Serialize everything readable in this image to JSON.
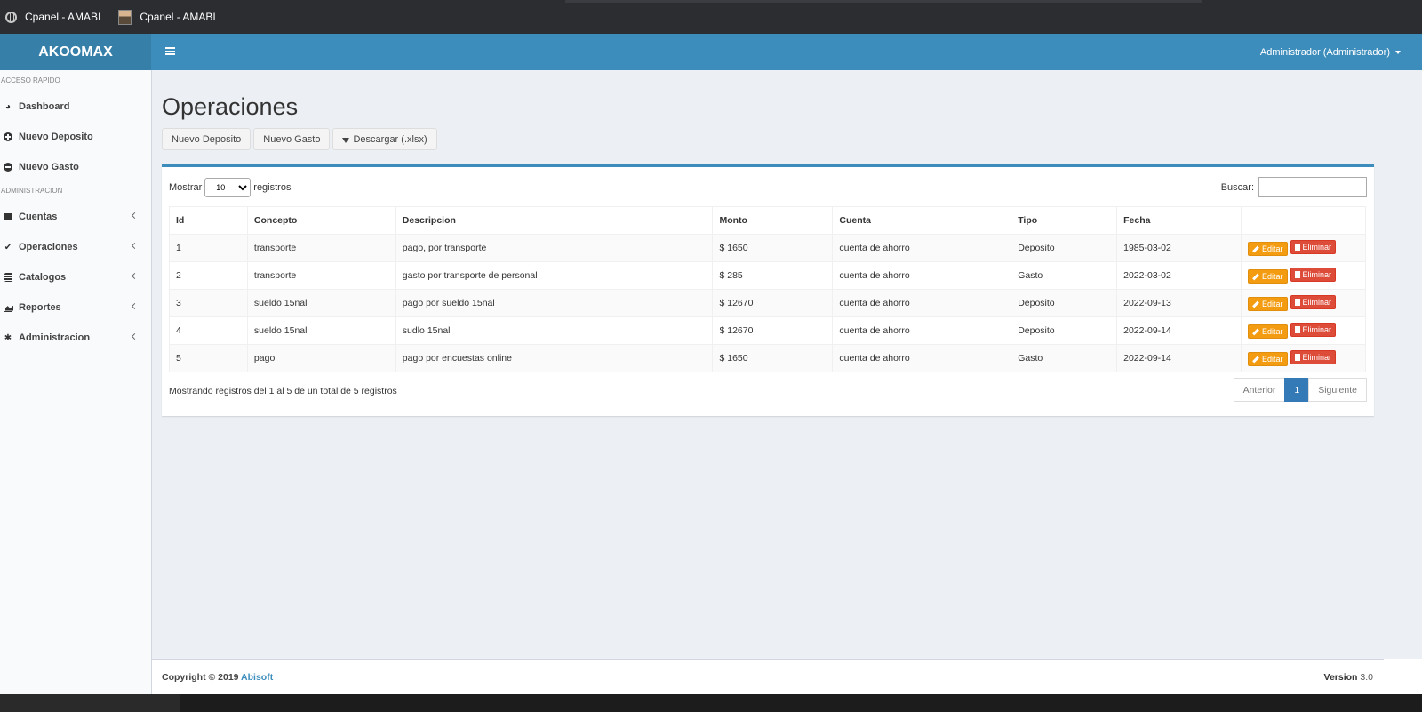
{
  "browser": {
    "tabs": [
      {
        "title": "Cpanel - AMABI",
        "icon": "globe-icon"
      },
      {
        "title": "Cpanel - AMABI",
        "icon": "user-photo-icon"
      }
    ]
  },
  "header": {
    "logo": "AKOOMAX",
    "user": "Administrador (Administrador)"
  },
  "sidebar": {
    "section1": "ACCESO RAPIDO",
    "quick": [
      {
        "label": "Dashboard",
        "icon": "dashboard-icon"
      },
      {
        "label": "Nuevo Deposito",
        "icon": "plus-circle-icon"
      },
      {
        "label": "Nuevo Gasto",
        "icon": "minus-circle-icon"
      }
    ],
    "section2": "ADMINISTRACION",
    "admin": [
      {
        "label": "Cuentas",
        "icon": "briefcase-icon"
      },
      {
        "label": "Operaciones",
        "icon": "check-icon"
      },
      {
        "label": "Catalogos",
        "icon": "database-icon"
      },
      {
        "label": "Reportes",
        "icon": "area-chart-icon"
      },
      {
        "label": "Administracion",
        "icon": "gear-icon"
      }
    ]
  },
  "page": {
    "title": "Operaciones",
    "buttons": {
      "nuevo_deposito": "Nuevo Deposito",
      "nuevo_gasto": "Nuevo Gasto",
      "descargar": "Descargar (.xlsx)"
    }
  },
  "table": {
    "length_prefix": "Mostrar",
    "length_value": "10",
    "length_suffix": "registros",
    "search_label": "Buscar:",
    "search_value": "",
    "columns": [
      "Id",
      "Concepto",
      "Descripcion",
      "Monto",
      "Cuenta",
      "Tipo",
      "Fecha",
      ""
    ],
    "edit_label": "Editar",
    "delete_label": "Eliminar",
    "rows": [
      [
        "1",
        "transporte",
        "pago, por transporte",
        "$ 1650",
        "cuenta de ahorro",
        "Deposito",
        "1985-03-02"
      ],
      [
        "2",
        "transporte",
        "gasto por transporte de personal",
        "$ 285",
        "cuenta de ahorro",
        "Gasto",
        "2022-03-02"
      ],
      [
        "3",
        "sueldo 15nal",
        "pago por sueldo 15nal",
        "$ 12670",
        "cuenta de ahorro",
        "Deposito",
        "2022-09-13"
      ],
      [
        "4",
        "sueldo 15nal",
        "sudlo 15nal",
        "$ 12670",
        "cuenta de ahorro",
        "Deposito",
        "2022-09-14"
      ],
      [
        "5",
        "pago",
        "pago por encuestas online",
        "$ 1650",
        "cuenta de ahorro",
        "Gasto",
        "2022-09-14"
      ]
    ],
    "info": "Mostrando registros del 1 al 5 de un total de 5 registros",
    "pager": {
      "prev": "Anterior",
      "current": "1",
      "next": "Siguiente"
    }
  },
  "footer": {
    "copyright": "Copyright © 2019",
    "company": "Abisoft",
    "version_label": "Version",
    "version_value": "3.0"
  },
  "colors": {
    "header": "#3c8dbc",
    "logo_bg": "#367fa9",
    "edit": "#f39c12",
    "delete": "#dd4b39",
    "pager_active": "#337ab7"
  }
}
